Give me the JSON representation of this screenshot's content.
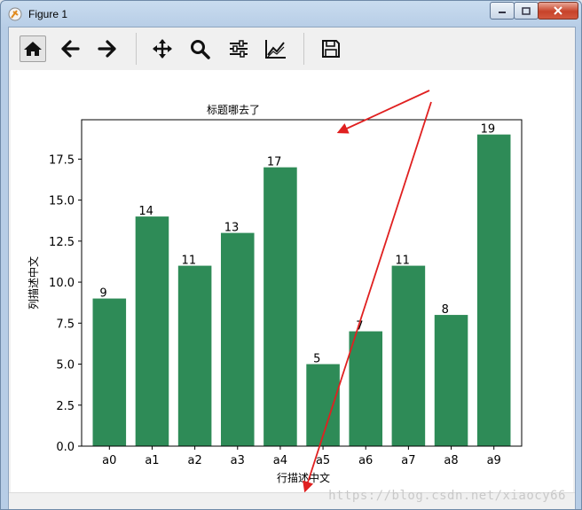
{
  "window": {
    "title": "Figure 1"
  },
  "toolbar": {
    "buttons": [
      {
        "id": "home",
        "icon": "home-icon"
      },
      {
        "id": "back",
        "icon": "arrow-left-icon"
      },
      {
        "id": "forward",
        "icon": "arrow-right-icon"
      },
      {
        "id": "pan",
        "icon": "move-icon"
      },
      {
        "id": "zoom",
        "icon": "magnifier-icon"
      },
      {
        "id": "subplots",
        "icon": "sliders-icon"
      },
      {
        "id": "edit",
        "icon": "line-chart-icon"
      },
      {
        "id": "save",
        "icon": "floppy-disk-icon"
      }
    ]
  },
  "chart_data": {
    "type": "bar",
    "title": "标题哪去了",
    "xlabel": "行描述中文",
    "ylabel": "列描述中文",
    "categories": [
      "a0",
      "a1",
      "a2",
      "a3",
      "a4",
      "a5",
      "a6",
      "a7",
      "a8",
      "a9"
    ],
    "values": [
      9,
      14,
      11,
      13,
      17,
      5,
      7,
      11,
      8,
      19
    ],
    "ylim": [
      0,
      19.9
    ],
    "yticks": [
      "0.0",
      "2.5",
      "5.0",
      "7.5",
      "10.0",
      "12.5",
      "15.0",
      "17.5"
    ],
    "ytick_values": [
      0,
      2.5,
      5,
      7.5,
      10,
      12.5,
      15,
      17.5
    ],
    "bar_color": "#2e8b57",
    "grid": false
  },
  "annotations": {
    "arrow_color": "#e02020"
  },
  "watermark": "https://blog.csdn.net/xiaocy66"
}
